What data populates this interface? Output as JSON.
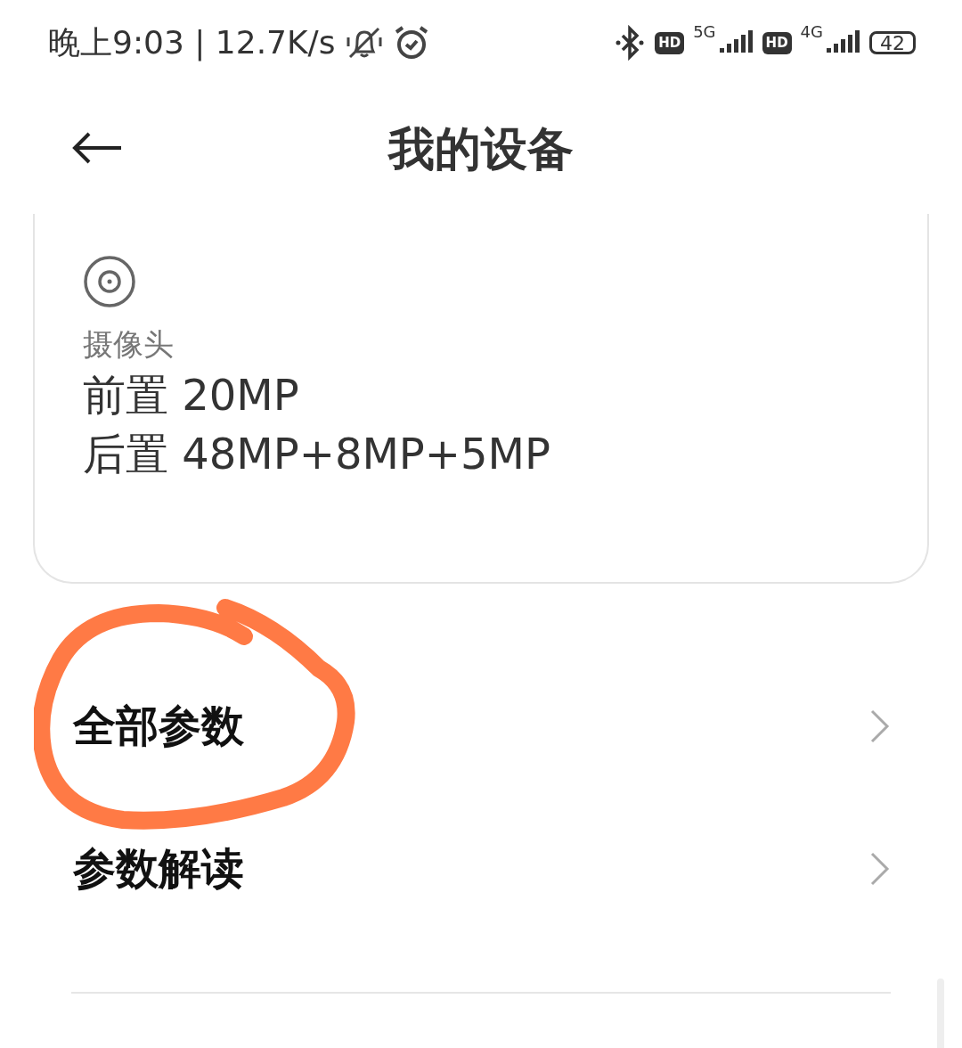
{
  "status_bar": {
    "time_speed": "晚上9:03 | 12.7K/s",
    "signals": [
      {
        "hd": "HD",
        "network": "5G"
      },
      {
        "hd": "HD",
        "network": "4G"
      }
    ],
    "battery": "42"
  },
  "header": {
    "title": "我的设备"
  },
  "card": {
    "label": "摄像头",
    "lines": [
      "前置 20MP",
      "后置 48MP+8MP+5MP"
    ]
  },
  "menu": [
    {
      "label": "全部参数"
    },
    {
      "label": "参数解读"
    }
  ]
}
